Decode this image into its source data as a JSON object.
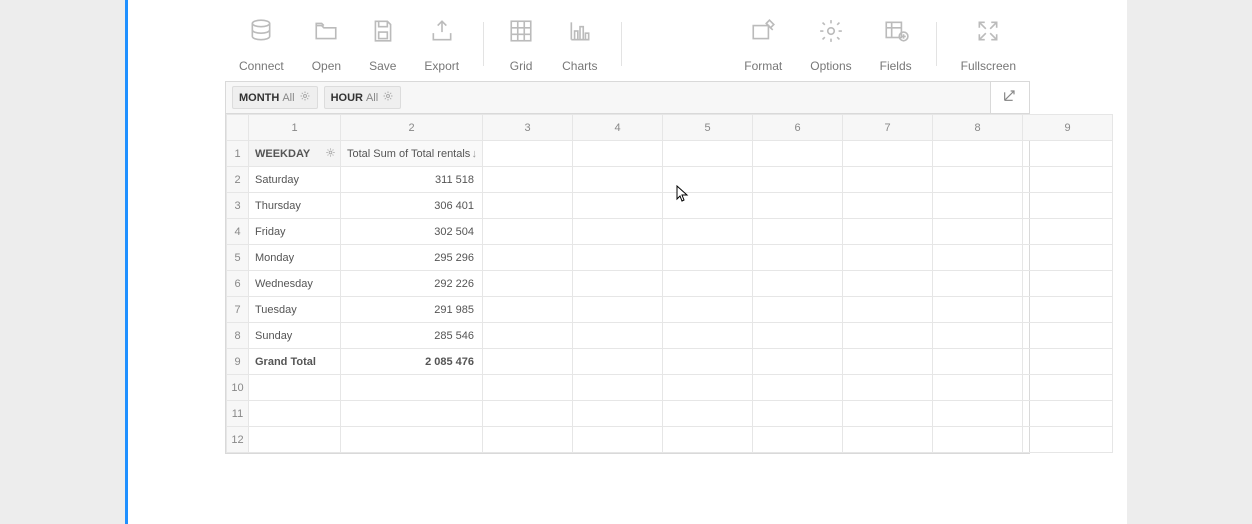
{
  "toolbar": {
    "connect": "Connect",
    "open": "Open",
    "save": "Save",
    "export": "Export",
    "grid": "Grid",
    "charts": "Charts",
    "format": "Format",
    "options": "Options",
    "fields": "Fields",
    "fullscreen": "Fullscreen"
  },
  "filters": [
    {
      "name": "MONTH",
      "scope": "All"
    },
    {
      "name": "HOUR",
      "scope": "All"
    }
  ],
  "column_headers": [
    "1",
    "2",
    "3",
    "4",
    "5",
    "6",
    "7",
    "8",
    "9"
  ],
  "header_row": {
    "rownum": "1",
    "field_label": "WEEKDAY",
    "value_label": "Total Sum of Total rentals"
  },
  "rows": [
    {
      "rownum": "2",
      "label": "Saturday",
      "value": "311 518"
    },
    {
      "rownum": "3",
      "label": "Thursday",
      "value": "306 401"
    },
    {
      "rownum": "4",
      "label": "Friday",
      "value": "302 504"
    },
    {
      "rownum": "5",
      "label": "Monday",
      "value": "295 296"
    },
    {
      "rownum": "6",
      "label": "Wednesday",
      "value": "292 226"
    },
    {
      "rownum": "7",
      "label": "Tuesday",
      "value": "291 985"
    },
    {
      "rownum": "8",
      "label": "Sunday",
      "value": "285 546"
    }
  ],
  "total_row": {
    "rownum": "9",
    "label": "Grand Total",
    "value": "2 085 476"
  },
  "empty_rows": [
    "10",
    "11",
    "12"
  ]
}
